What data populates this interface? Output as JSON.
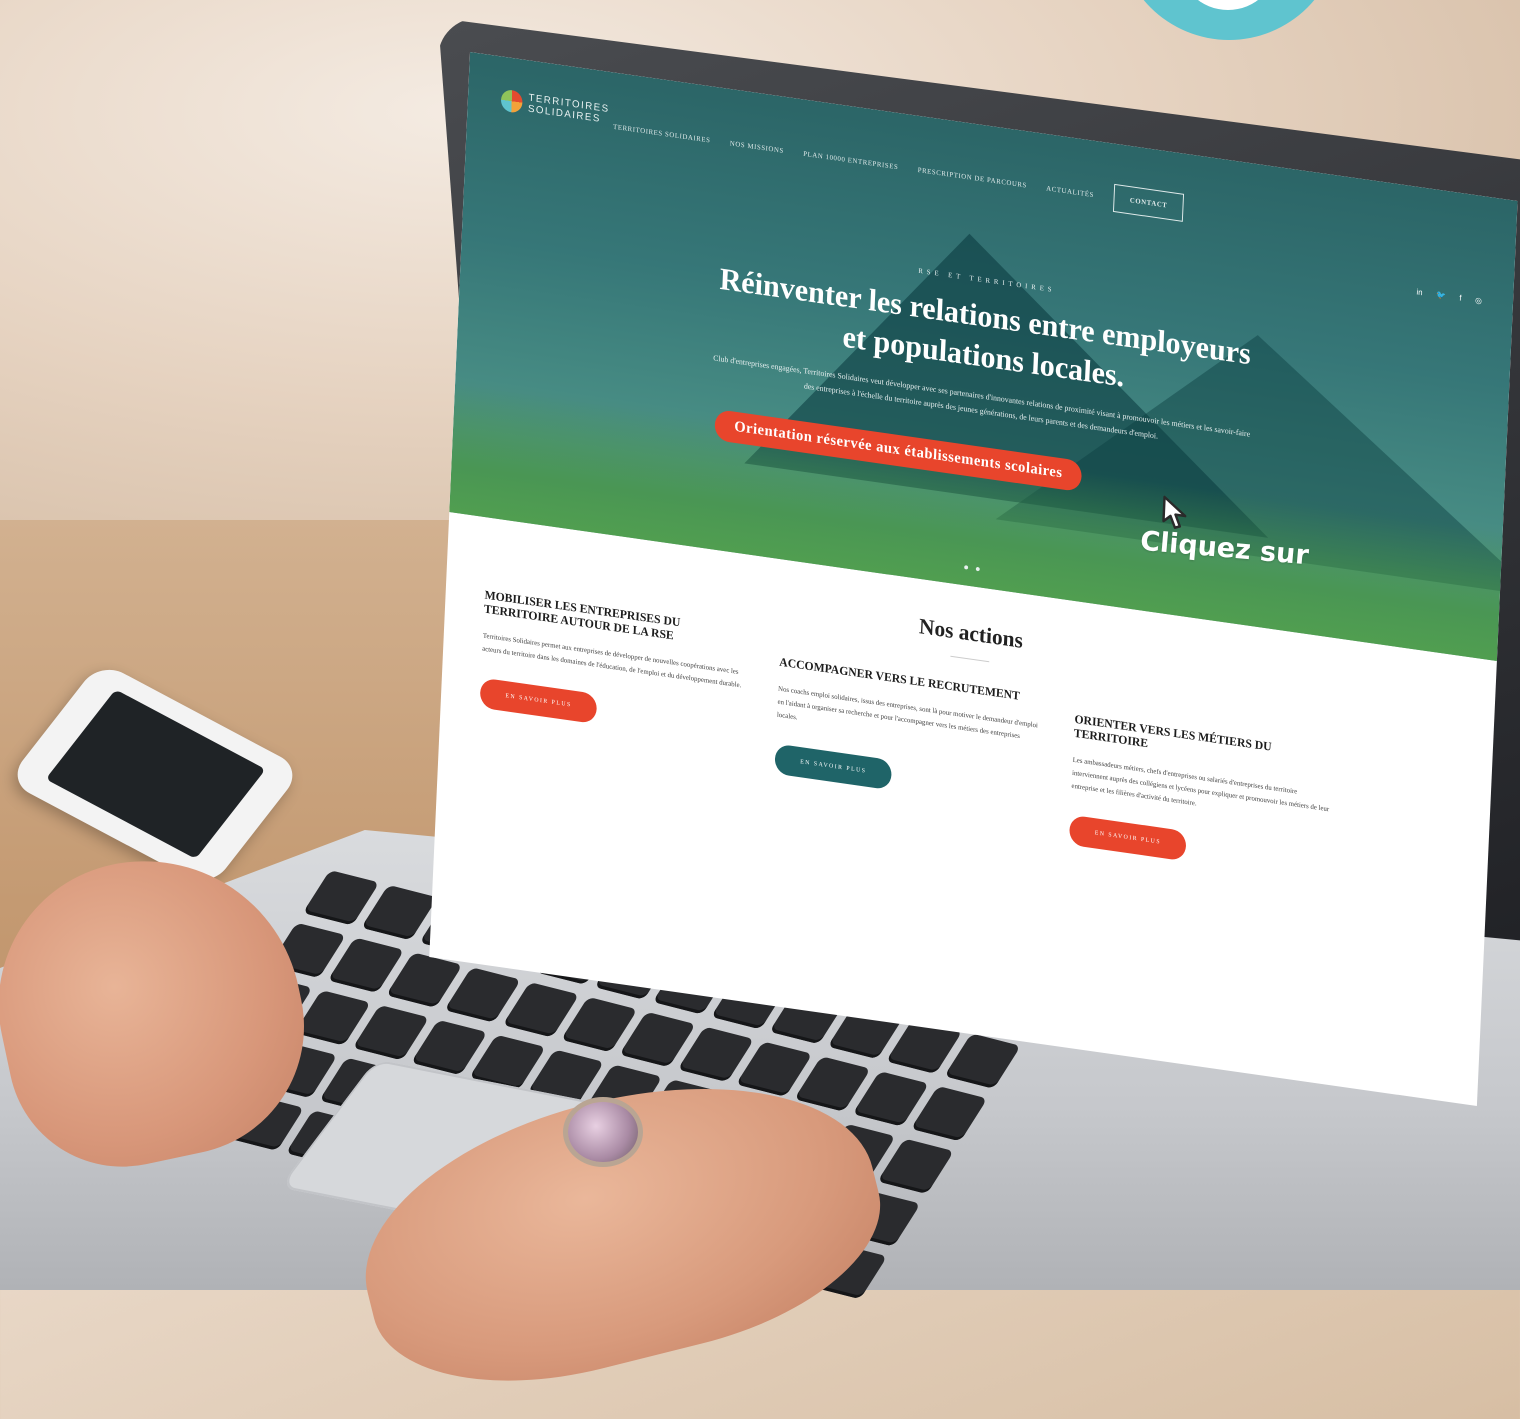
{
  "site": {
    "logo_line1": "TERRITOIRES",
    "logo_line2": "SOLIDAIRES",
    "nav": [
      "TERRITOIRES SOLIDAIRES",
      "NOS MISSIONS",
      "PLAN 10000 ENTREPRISES",
      "PRESCRIPTION DE PARCOURS",
      "ACTUALITÉS"
    ],
    "contact_label": "CONTACT",
    "social": [
      "in",
      "🐦",
      "f",
      "◎"
    ]
  },
  "hero": {
    "eyebrow": "RSE ET TERRITOIRES",
    "title_line1": "Réinventer les relations entre employeurs",
    "title_line2": "et populations locales.",
    "lead": "Club d'entreprises engagées, Territoires Solidaires veut développer avec ses partenaires d'innovantes relations de proximité visant à promouvoir les métiers et les savoir-faire des entreprises à l'échelle du territoire auprès des jeunes générations, de leurs parents et des demandeurs d'emploi.",
    "cta_label": "Orientation réservée aux établissements scolaires"
  },
  "actions": {
    "heading": "Nos actions",
    "items": [
      {
        "title": "MOBILISER LES ENTREPRISES DU TERRITOIRE AUTOUR DE LA RSE",
        "text": "Territoires Solidaires permet aux entreprises de développer de nouvelles coopérations avec les acteurs du territoire dans les domaines de l'éducation, de l'emploi et du développement durable.",
        "button": "EN SAVOIR PLUS",
        "button_color": "#e8452c"
      },
      {
        "title": "ACCOMPAGNER VERS LE RECRUTEMENT",
        "text": "Nos coachs emploi solidaires, issus des entreprises, sont là pour motiver le demandeur d'emploi en l'aidant à organiser sa recherche et pour l'accompagner vers les métiers des entreprises locales.",
        "button": "EN SAVOIR PLUS",
        "button_color": "#1f6468"
      },
      {
        "title": "ORIENTER VERS LES MÉTIERS DU TERRITOIRE",
        "text": "Les ambassadeurs métiers, chefs d'entreprises ou salariés d'entreprises du territoire interviennent auprès des collégiens et lycéens pour expliquer et promouvoir les métiers de leur entreprise et les filières d'activité du territoire.",
        "button": "EN SAVOIR PLUS",
        "button_color": "#e8452c"
      }
    ]
  },
  "overlay": {
    "callout": "Cliquez sur"
  },
  "colors": {
    "accent_red": "#e8452c",
    "teal": "#1f6468",
    "bubble": "#5fc4cf"
  }
}
